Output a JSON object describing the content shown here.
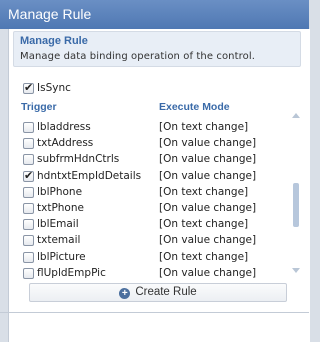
{
  "window": {
    "title": "Manage Rule"
  },
  "card": {
    "title": "Manage Rule",
    "description": "Manage data binding operation of the control."
  },
  "issync": {
    "label": "IsSync",
    "checked": true
  },
  "table": {
    "headers": {
      "trigger": "Trigger",
      "mode": "Execute Mode"
    },
    "rows": [
      {
        "name": "lbladdress",
        "mode": "[On text change]",
        "checked": false
      },
      {
        "name": "txtAddress",
        "mode": "[On value change]",
        "checked": false
      },
      {
        "name": "subfrmHdnCtrls",
        "mode": "[On value change]",
        "checked": false
      },
      {
        "name": "hdntxtEmpIdDetails",
        "mode": "[On value change]",
        "checked": true
      },
      {
        "name": "lblPhone",
        "mode": "[On text change]",
        "checked": false
      },
      {
        "name": "txtPhone",
        "mode": "[On value change]",
        "checked": false
      },
      {
        "name": "lblEmail",
        "mode": "[On text change]",
        "checked": false
      },
      {
        "name": "txtemail",
        "mode": "[On value change]",
        "checked": false
      },
      {
        "name": "lblPicture",
        "mode": "[On text change]",
        "checked": false
      },
      {
        "name": "flUpldEmpPic",
        "mode": "[On value change]",
        "checked": false
      }
    ]
  },
  "buttons": {
    "create_rule": "Create Rule"
  },
  "icons": {
    "create": "plus-circle-icon"
  },
  "colors": {
    "title_bar": "#5a82bb",
    "accent_text": "#3a6aa8"
  }
}
